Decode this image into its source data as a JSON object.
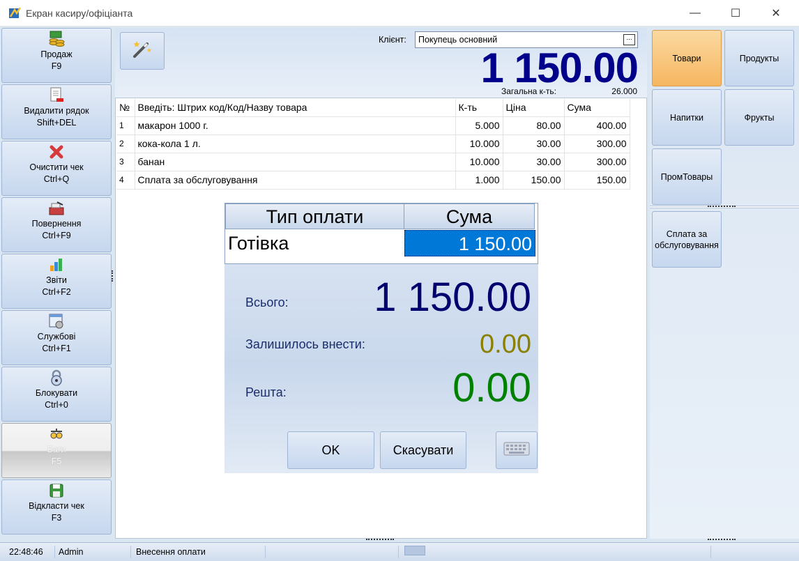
{
  "window": {
    "title": "Екран касиру/офіціанта",
    "minimize": "—",
    "maximize": "☐",
    "close": "✕"
  },
  "sidebar": {
    "items": [
      {
        "name": "sale",
        "label": "Продаж",
        "shortcut": "F9",
        "icon": "coins-icon",
        "glyph": "🪙",
        "disabled": false
      },
      {
        "name": "delete-row",
        "label": "Видалити рядок",
        "shortcut": "Shift+DEL",
        "icon": "document-delete-icon",
        "glyph": "📄",
        "disabled": false
      },
      {
        "name": "clear-check",
        "label": "Очистити чек",
        "shortcut": "Ctrl+Q",
        "icon": "red-x-icon",
        "glyph": "✖",
        "disabled": false
      },
      {
        "name": "return",
        "label": "Повернення",
        "shortcut": "Ctrl+F9",
        "icon": "cash-register-return-icon",
        "glyph": "📠",
        "disabled": false
      },
      {
        "name": "reports",
        "label": "Звіти",
        "shortcut": "Ctrl+F2",
        "icon": "bar-chart-icon",
        "glyph": "📊",
        "disabled": false
      },
      {
        "name": "service",
        "label": "Службові",
        "shortcut": "Ctrl+F1",
        "icon": "settings-window-icon",
        "glyph": "🗔",
        "disabled": false
      },
      {
        "name": "lock",
        "label": "Блокувати",
        "shortcut": "Ctrl+0",
        "icon": "padlock-icon",
        "glyph": "🔒",
        "disabled": false
      },
      {
        "name": "scales",
        "label": "Ваги",
        "shortcut": "F5",
        "icon": "scales-icon",
        "glyph": "⚖",
        "disabled": true
      },
      {
        "name": "postpone",
        "label": "Відкласти чек",
        "shortcut": "F3",
        "icon": "floppy-disk-icon",
        "glyph": "💾",
        "disabled": false
      }
    ]
  },
  "header": {
    "wand_icon": "magic-wand-icon",
    "client_label": "Клієнт:",
    "client_value": "Покупець основний",
    "client_browse": "...",
    "total": "1 150.00",
    "qty_label": "Загальна к-ть:",
    "qty_value": "26.000"
  },
  "items_table": {
    "columns": [
      "№",
      "Введіть: Штрих код/Код/Назву товара",
      "К-ть",
      "Ціна",
      "Сума"
    ],
    "rows": [
      [
        "1",
        "макарон 1000 г.",
        "5.000",
        "80.00",
        "400.00"
      ],
      [
        "2",
        "кока-кола 1 л.",
        "10.000",
        "30.00",
        "300.00"
      ],
      [
        "3",
        "банан",
        "10.000",
        "30.00",
        "300.00"
      ],
      [
        "4",
        "Сплата за обслуговування",
        "1.000",
        "150.00",
        "150.00"
      ]
    ]
  },
  "payment": {
    "col_type": "Тип оплати",
    "col_sum": "Сума",
    "type": "Готівка",
    "sum": "1 150.00",
    "total_label": "Всього:",
    "total_value": "1 150.00",
    "remain_label": "Залишилось внести:",
    "remain_value": "0.00",
    "change_label": "Решта:",
    "change_value": "0.00",
    "ok": "OK",
    "cancel": "Скасувати",
    "keyboard_icon": "keyboard-icon"
  },
  "categories": [
    {
      "label": "Товари",
      "active": true
    },
    {
      "label": "Продукты",
      "active": false
    },
    {
      "label": "Напитки",
      "active": false
    },
    {
      "label": "Фрукты",
      "active": false
    },
    {
      "label": "ПромТовары",
      "active": false
    }
  ],
  "quick_items": [
    {
      "label": "Сплата за обслуговування"
    }
  ],
  "status": {
    "time": "22:48:46",
    "user": "Admin",
    "mode": "Внесення оплати"
  },
  "colors": {
    "total": "#00008b",
    "remain": "#8b8000",
    "change": "#008000",
    "selection": "#0078d7",
    "active_category": "#f6b660"
  }
}
